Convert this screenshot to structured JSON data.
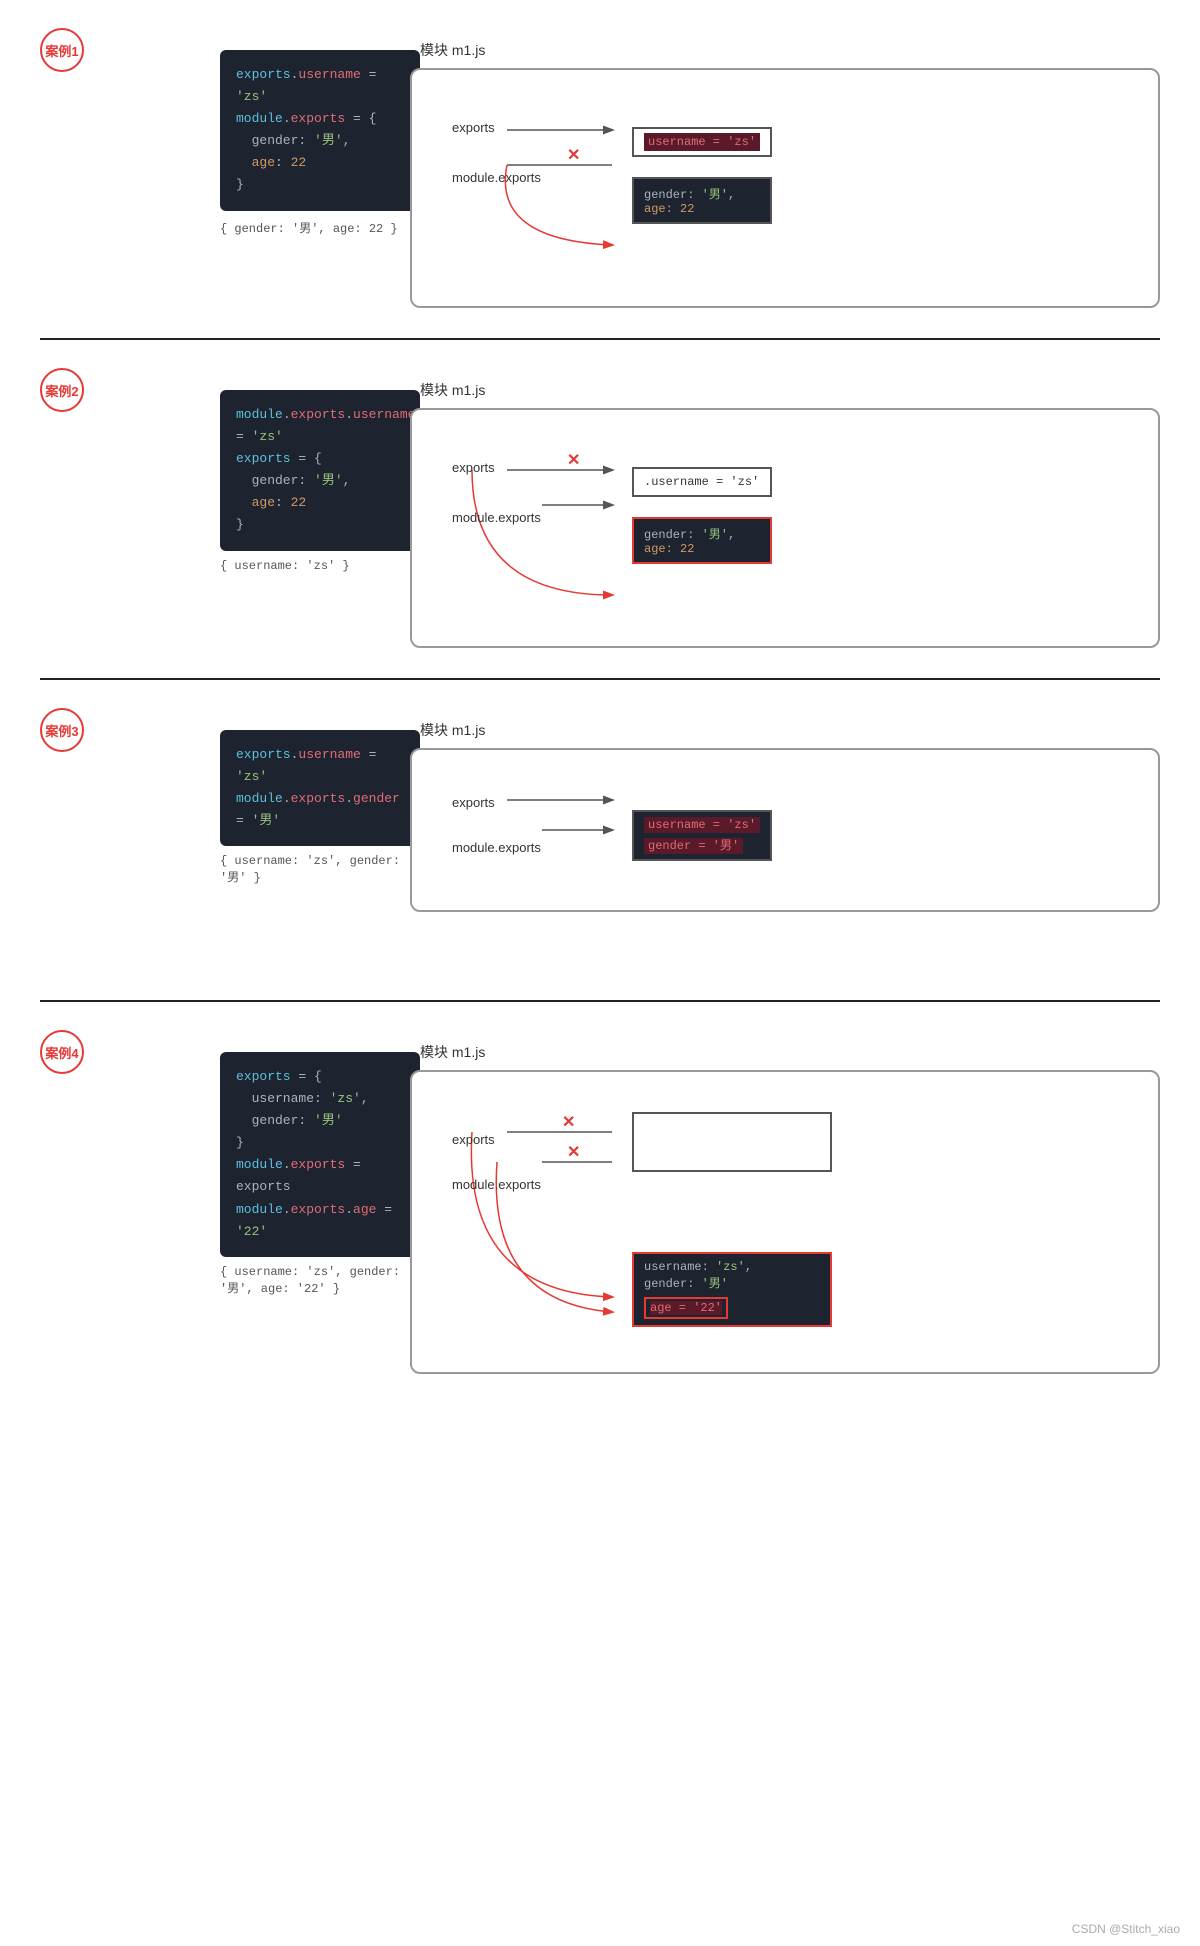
{
  "sections": [
    {
      "id": "section1",
      "badge": "案例1",
      "code_lines": [
        {
          "parts": [
            {
              "text": "exports",
              "class": "c-blue"
            },
            {
              "text": ".",
              "class": "c-white"
            },
            {
              "text": "username",
              "class": "c-red"
            },
            {
              "text": " = ",
              "class": "c-white"
            },
            {
              "text": "'zs'",
              "class": "c-green"
            }
          ]
        },
        {
          "parts": [
            {
              "text": "module",
              "class": "c-blue"
            },
            {
              "text": ".",
              "class": "c-white"
            },
            {
              "text": "exports",
              "class": "c-red"
            },
            {
              "text": " = {",
              "class": "c-white"
            }
          ]
        },
        {
          "parts": [
            {
              "text": "  gender",
              "class": "c-white"
            },
            {
              "text": ": ",
              "class": "c-white"
            },
            {
              "text": "'男'",
              "class": "c-green"
            },
            {
              "text": ",",
              "class": "c-white"
            }
          ]
        },
        {
          "parts": [
            {
              "text": "  age",
              "class": "c-orange"
            },
            {
              "text": ": ",
              "class": "c-white"
            },
            {
              "text": "22",
              "class": "c-orange"
            }
          ]
        },
        {
          "parts": [
            {
              "text": "}",
              "class": "c-white"
            }
          ]
        }
      ],
      "result": "{ gender: '男', age: 22 }",
      "module_label": "模块  m1.js",
      "exports_label": "exports",
      "module_exports_label": "module.exports",
      "box1_content": "username = 'zs'",
      "box1_type": "normal_red_bg",
      "box2_content": [
        "gender: '男',",
        "age: 22"
      ],
      "box2_type": "normal",
      "exports_arrow": "to_box1",
      "module_exports_arrow": "cross_to_box2",
      "box1_selected": true,
      "box2_selected": false
    },
    {
      "id": "section2",
      "badge": "案例2",
      "code_lines": [
        {
          "parts": [
            {
              "text": "module",
              "class": "c-blue"
            },
            {
              "text": ".",
              "class": "c-white"
            },
            {
              "text": "exports",
              "class": "c-red"
            },
            {
              "text": ".",
              "class": "c-white"
            },
            {
              "text": "username",
              "class": "c-red"
            },
            {
              "text": " = ",
              "class": "c-white"
            },
            {
              "text": "'zs'",
              "class": "c-green"
            }
          ]
        },
        {
          "parts": [
            {
              "text": "exports",
              "class": "c-blue"
            },
            {
              "text": " = {",
              "class": "c-white"
            }
          ]
        },
        {
          "parts": [
            {
              "text": "  gender",
              "class": "c-white"
            },
            {
              "text": ": ",
              "class": "c-white"
            },
            {
              "text": "'男'",
              "class": "c-green"
            },
            {
              "text": ",",
              "class": "c-white"
            }
          ]
        },
        {
          "parts": [
            {
              "text": "  age",
              "class": "c-orange"
            },
            {
              "text": ": ",
              "class": "c-white"
            },
            {
              "text": "22",
              "class": "c-orange"
            }
          ]
        },
        {
          "parts": [
            {
              "text": "}",
              "class": "c-white"
            }
          ]
        }
      ],
      "result": "{ username: 'zs' }",
      "module_label": "模块  m1.js",
      "exports_label": "exports",
      "module_exports_label": "module.exports",
      "box1_content": ".username = 'zs'",
      "box1_type": "normal",
      "box2_content": [
        "gender: '男',",
        "age: 22"
      ],
      "box2_type": "red_border",
      "exports_arrow": "cross_to_box1",
      "module_exports_arrow": "to_box1",
      "box1_selected": false,
      "box2_selected": true
    },
    {
      "id": "section3",
      "badge": "案例3",
      "code_lines": [
        {
          "parts": [
            {
              "text": "exports",
              "class": "c-blue"
            },
            {
              "text": ".",
              "class": "c-white"
            },
            {
              "text": "username",
              "class": "c-red"
            },
            {
              "text": " = ",
              "class": "c-white"
            },
            {
              "text": "'zs'",
              "class": "c-green"
            }
          ]
        },
        {
          "parts": [
            {
              "text": "module",
              "class": "c-blue"
            },
            {
              "text": ".",
              "class": "c-white"
            },
            {
              "text": "exports",
              "class": "c-red"
            },
            {
              "text": ".",
              "class": "c-white"
            },
            {
              "text": "gender",
              "class": "c-red"
            },
            {
              "text": " = ",
              "class": "c-white"
            },
            {
              "text": "'男'",
              "class": "c-green"
            }
          ]
        }
      ],
      "result": "{ username: 'zs', gender: '男' }",
      "module_label": "模块  m1.js",
      "exports_label": "exports",
      "module_exports_label": "module.exports",
      "box1_content": [
        "username = 'zs'",
        "gender = '男'"
      ],
      "box1_type": "normal",
      "box2_content": null,
      "exports_arrow": "to_box1",
      "module_exports_arrow": "to_box1",
      "single_box": true
    },
    {
      "id": "section4",
      "badge": "案例4",
      "code_lines": [
        {
          "parts": [
            {
              "text": "exports",
              "class": "c-blue"
            },
            {
              "text": " = {",
              "class": "c-white"
            }
          ]
        },
        {
          "parts": [
            {
              "text": "  username",
              "class": "c-white"
            },
            {
              "text": ": ",
              "class": "c-white"
            },
            {
              "text": "'zs'",
              "class": "c-green"
            },
            {
              "text": ",",
              "class": "c-white"
            }
          ]
        },
        {
          "parts": [
            {
              "text": "  gender",
              "class": "c-white"
            },
            {
              "text": ": ",
              "class": "c-white"
            },
            {
              "text": "'男'",
              "class": "c-green"
            }
          ]
        },
        {
          "parts": [
            {
              "text": "}",
              "class": "c-white"
            }
          ]
        },
        {
          "parts": [
            {
              "text": "module",
              "class": "c-blue"
            },
            {
              "text": ".",
              "class": "c-white"
            },
            {
              "text": "exports",
              "class": "c-red"
            },
            {
              "text": " = exports",
              "class": "c-white"
            }
          ]
        },
        {
          "parts": [
            {
              "text": "module",
              "class": "c-blue"
            },
            {
              "text": ".",
              "class": "c-white"
            },
            {
              "text": "exports",
              "class": "c-red"
            },
            {
              "text": ".",
              "class": "c-white"
            },
            {
              "text": "age",
              "class": "c-red"
            },
            {
              "text": " = ",
              "class": "c-white"
            },
            {
              "text": "'22'",
              "class": "c-green"
            }
          ]
        }
      ],
      "result": "{ username: 'zs', gender: '男', age: '22' }",
      "module_label": "模块  m1.js",
      "exports_label": "exports",
      "module_exports_label": "module.exports",
      "box1_content": [
        "username: 'zs',",
        "gender: '男'"
      ],
      "box2_content": [
        "age = '22'"
      ],
      "box1_type": "normal",
      "box2_type": "red_border_with_age",
      "exports_arrow": "cross_to_box1",
      "module_exports_arrow": "cross_to_box2_curve"
    }
  ],
  "footer": "CSDN @Stitch_xiao"
}
